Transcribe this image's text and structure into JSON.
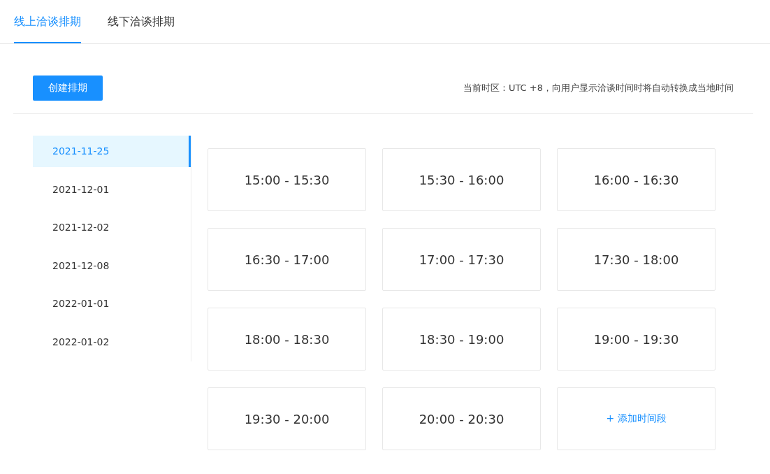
{
  "tabs": [
    {
      "label": "线上洽谈排期",
      "selected": true
    },
    {
      "label": "线下洽谈排期",
      "selected": false
    }
  ],
  "toolbar": {
    "create_button": "创建排期",
    "timezone_note": "当前时区：UTC +8，向用户显示洽谈时间时将自动转换成当地时间"
  },
  "dates": [
    {
      "label": "2021-11-25",
      "selected": true
    },
    {
      "label": "2021-12-01",
      "selected": false
    },
    {
      "label": "2021-12-02",
      "selected": false
    },
    {
      "label": "2021-12-08",
      "selected": false
    },
    {
      "label": "2022-01-01",
      "selected": false
    },
    {
      "label": "2022-01-02",
      "selected": false
    }
  ],
  "slots": [
    {
      "kind": "time",
      "label": "15:00 - 15:30"
    },
    {
      "kind": "time",
      "label": "15:30 - 16:00"
    },
    {
      "kind": "time",
      "label": "16:00 - 16:30"
    },
    {
      "kind": "time",
      "label": "16:30 - 17:00"
    },
    {
      "kind": "time",
      "label": "17:00 - 17:30"
    },
    {
      "kind": "time",
      "label": "17:30 - 18:00"
    },
    {
      "kind": "time",
      "label": "18:00 - 18:30"
    },
    {
      "kind": "time",
      "label": "18:30 - 19:00"
    },
    {
      "kind": "time",
      "label": "19:00 - 19:30"
    },
    {
      "kind": "time",
      "label": "19:30 - 20:00"
    },
    {
      "kind": "time",
      "label": "20:00 - 20:30"
    },
    {
      "kind": "add",
      "label": "+ 添加时间段"
    }
  ]
}
